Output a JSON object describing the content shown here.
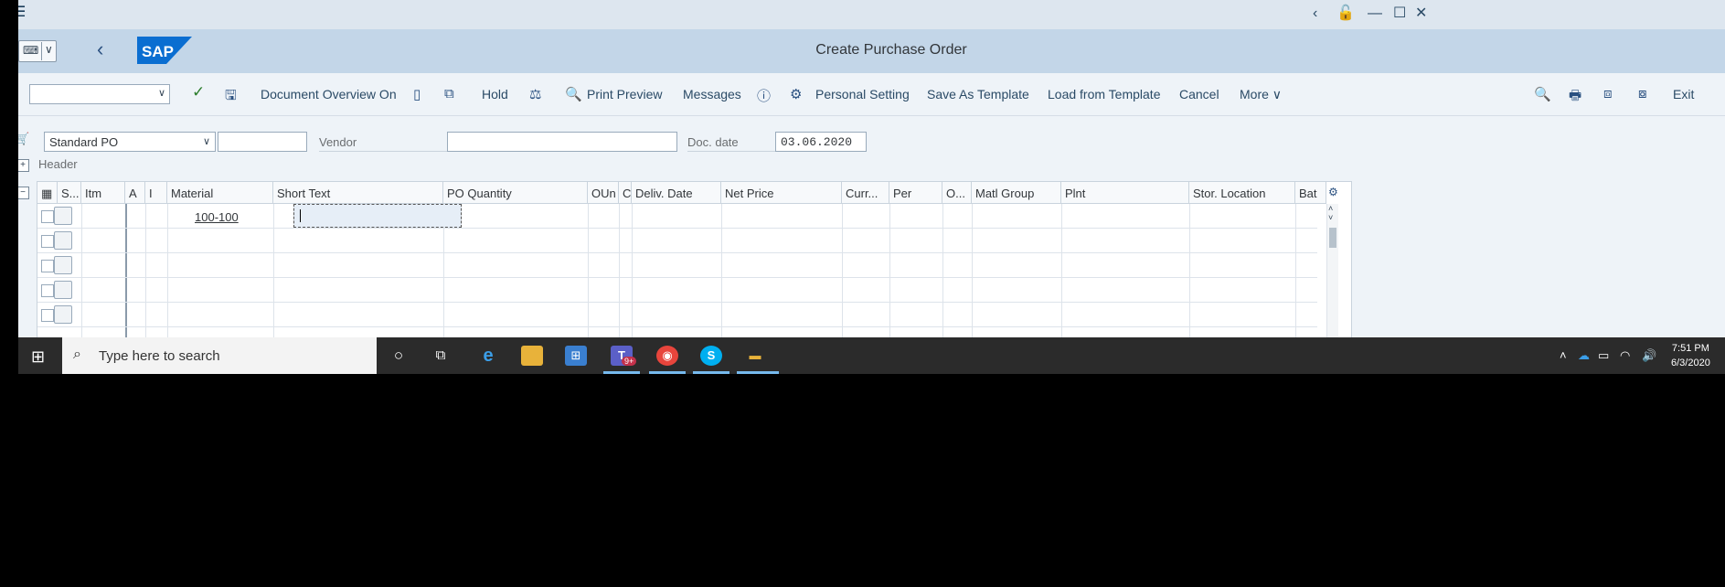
{
  "app": {
    "title": "Create Purchase Order",
    "brand": "SAP"
  },
  "toolbar": {
    "document_overview": "Document Overview On",
    "hold": "Hold",
    "print_preview": "Print Preview",
    "messages": "Messages",
    "personal_setting": "Personal Setting",
    "save_as_template": "Save As Template",
    "load_from_template": "Load from Template",
    "cancel": "Cancel",
    "more": "More",
    "exit": "Exit"
  },
  "header_fields": {
    "po_type": "Standard PO",
    "vendor_label": "Vendor",
    "doc_date_label": "Doc. date",
    "doc_date": "03.06.2020",
    "header_label": "Header"
  },
  "table": {
    "columns": [
      "S...",
      "Itm",
      "A",
      "I",
      "Material",
      "Short Text",
      "PO Quantity",
      "OUn",
      "C",
      "Deliv. Date",
      "Net Price",
      "Curr...",
      "Per",
      "O...",
      "Matl Group",
      "Plnt",
      "Stor. Location",
      "Bat"
    ],
    "rows": [
      {
        "material": "100-100"
      }
    ]
  },
  "taskbar": {
    "search_placeholder": "Type here to search",
    "teams_badge": "9+",
    "time": "7:51 PM",
    "date": "6/3/2020"
  },
  "colors": {
    "shellbar": "#c3d6e8",
    "sap_blue": "#0a6ed1",
    "accept_green": "#2b7d2b"
  }
}
